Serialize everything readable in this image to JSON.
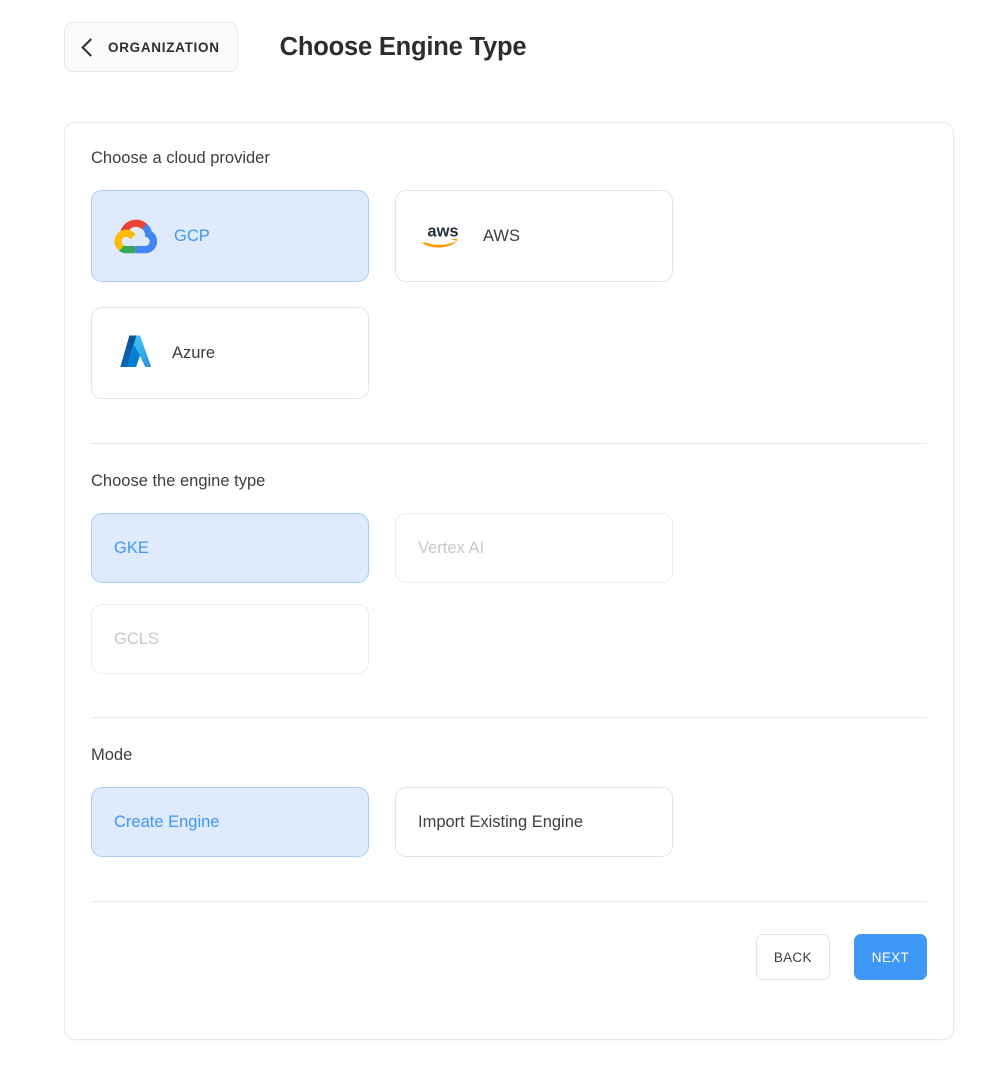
{
  "header": {
    "back_label": "ORGANIZATION",
    "back_icon": "chevron-left-icon",
    "title": "Choose Engine Type"
  },
  "sections": {
    "provider": {
      "label": "Choose a cloud provider",
      "options": [
        {
          "id": "gcp",
          "label": "GCP",
          "icon": "google-cloud-logo",
          "state": "selected"
        },
        {
          "id": "aws",
          "label": "AWS",
          "icon": "aws-logo",
          "state": "default"
        },
        {
          "id": "azure",
          "label": "Azure",
          "icon": "microsoft-azure-logo",
          "state": "default"
        }
      ]
    },
    "engine": {
      "label": "Choose the engine type",
      "options": [
        {
          "id": "gke",
          "label": "GKE",
          "state": "selected"
        },
        {
          "id": "vertexai",
          "label": "Vertex AI",
          "state": "disabled"
        },
        {
          "id": "gcls",
          "label": "GCLS",
          "state": "disabled"
        }
      ]
    },
    "mode": {
      "label": "Mode",
      "options": [
        {
          "id": "create",
          "label": "Create Engine",
          "state": "selected"
        },
        {
          "id": "import",
          "label": "Import Existing Engine",
          "state": "default"
        }
      ]
    }
  },
  "footer": {
    "back_label": "BACK",
    "next_label": "NEXT"
  },
  "colors": {
    "accent": "#3f97f6",
    "selected_bg": "#dfeafd",
    "selected_border": "#a8cdf5",
    "text": "#3c4043",
    "disabled_text": "#c6c8ca",
    "border": "#e2e4e7"
  }
}
